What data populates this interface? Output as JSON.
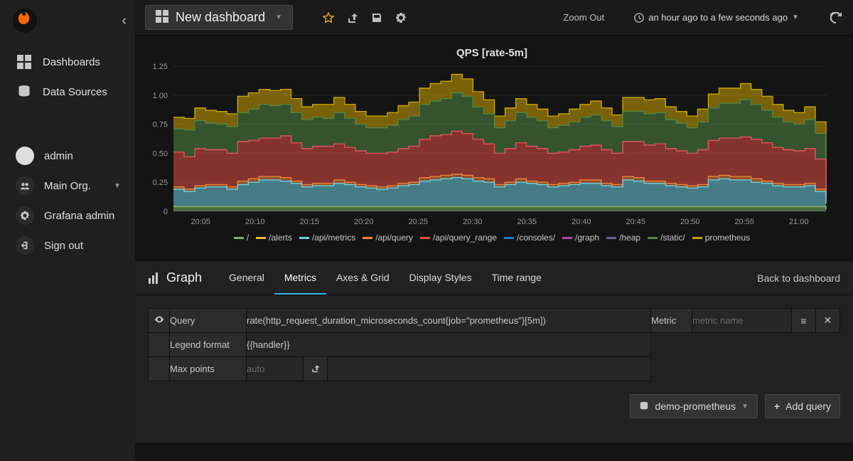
{
  "sidebar": {
    "nav": [
      {
        "label": "Dashboards",
        "icon": "dashboards"
      },
      {
        "label": "Data Sources",
        "icon": "datasources"
      }
    ],
    "user": "admin",
    "org": "Main Org.",
    "admin_link": "Grafana admin",
    "signout": "Sign out"
  },
  "topbar": {
    "dashboard_title": "New dashboard",
    "zoom_out": "Zoom Out",
    "time_range": "an hour ago to a few seconds ago"
  },
  "panel": {
    "title": "QPS [rate-5m]"
  },
  "editor": {
    "panel_type": "Graph",
    "tabs": [
      "General",
      "Metrics",
      "Axes & Grid",
      "Display Styles",
      "Time range"
    ],
    "active_tab": 1,
    "back": "Back to dashboard",
    "query_label": "Query",
    "query_value": "rate(http_request_duration_microseconds_count{job=\"prometheus\"}[5m])",
    "metric_label": "Metric",
    "metric_placeholder": "metric name",
    "legend_label": "Legend format",
    "legend_value": "{{handler}}",
    "maxpoints_label": "Max points",
    "maxpoints_placeholder": "auto",
    "datasource": "demo-prometheus",
    "add_query": "Add query"
  },
  "chart_data": {
    "type": "area",
    "title": "QPS [rate-5m]",
    "xlabel": "",
    "ylabel": "",
    "ylim": [
      0,
      1.25
    ],
    "yticks": [
      0,
      0.25,
      0.5,
      0.75,
      1.0,
      1.25
    ],
    "xticks": [
      "20:05",
      "20:10",
      "20:15",
      "20:20",
      "20:25",
      "20:30",
      "20:35",
      "20:40",
      "20:45",
      "20:50",
      "20:55",
      "21:00"
    ],
    "x": [
      0,
      1,
      2,
      3,
      4,
      5,
      6,
      7,
      8,
      9,
      10,
      11,
      12,
      13,
      14,
      15,
      16,
      17,
      18,
      19,
      20,
      21,
      22,
      23,
      24,
      25,
      26,
      27,
      28,
      29,
      30,
      31,
      32,
      33,
      34,
      35,
      36,
      37,
      38,
      39,
      40,
      41,
      42,
      43,
      44,
      45,
      46,
      47,
      48,
      49,
      50,
      51,
      52,
      53,
      54,
      55,
      56,
      57,
      58,
      59,
      60,
      61
    ],
    "stacked": true,
    "legend_position": "bottom",
    "series": [
      {
        "name": "/",
        "color": "#7eb26d",
        "values": [
          0.04,
          0.04,
          0.04,
          0.04,
          0.04,
          0.04,
          0.04,
          0.04,
          0.04,
          0.04,
          0.04,
          0.04,
          0.04,
          0.04,
          0.04,
          0.04,
          0.04,
          0.04,
          0.04,
          0.04,
          0.04,
          0.04,
          0.04,
          0.04,
          0.04,
          0.04,
          0.04,
          0.04,
          0.04,
          0.04,
          0.04,
          0.04,
          0.04,
          0.04,
          0.04,
          0.04,
          0.04,
          0.04,
          0.04,
          0.04,
          0.04,
          0.04,
          0.04,
          0.04,
          0.04,
          0.04,
          0.04,
          0.04,
          0.04,
          0.04,
          0.04,
          0.04,
          0.04,
          0.04,
          0.04,
          0.04,
          0.04,
          0.04,
          0.04,
          0.04,
          0.04,
          0.02
        ]
      },
      {
        "name": "/alerts",
        "color": "#eab839",
        "values": [
          0,
          0,
          0,
          0,
          0,
          0,
          0,
          0,
          0,
          0,
          0,
          0,
          0,
          0,
          0,
          0,
          0,
          0,
          0,
          0,
          0,
          0,
          0,
          0,
          0,
          0,
          0,
          0,
          0,
          0,
          0,
          0,
          0,
          0,
          0,
          0,
          0,
          0,
          0,
          0,
          0,
          0,
          0,
          0,
          0,
          0,
          0,
          0,
          0,
          0,
          0,
          0,
          0,
          0,
          0,
          0,
          0,
          0,
          0,
          0,
          0,
          0
        ]
      },
      {
        "name": "/api/metrics",
        "color": "#6ed0e0",
        "values": [
          0.15,
          0.13,
          0.16,
          0.17,
          0.17,
          0.15,
          0.19,
          0.21,
          0.23,
          0.23,
          0.22,
          0.2,
          0.17,
          0.18,
          0.18,
          0.2,
          0.19,
          0.17,
          0.16,
          0.15,
          0.16,
          0.18,
          0.19,
          0.22,
          0.23,
          0.24,
          0.25,
          0.24,
          0.22,
          0.21,
          0.17,
          0.19,
          0.21,
          0.2,
          0.19,
          0.17,
          0.18,
          0.19,
          0.2,
          0.2,
          0.18,
          0.17,
          0.23,
          0.22,
          0.2,
          0.2,
          0.18,
          0.17,
          0.16,
          0.17,
          0.23,
          0.24,
          0.23,
          0.23,
          0.21,
          0.2,
          0.18,
          0.17,
          0.17,
          0.18,
          0.13,
          0.05
        ]
      },
      {
        "name": "/api/query",
        "color": "#ef843c",
        "values": [
          0.02,
          0.02,
          0.02,
          0.02,
          0.02,
          0.02,
          0.03,
          0.03,
          0.03,
          0.03,
          0.03,
          0.02,
          0.02,
          0.02,
          0.02,
          0.03,
          0.02,
          0.02,
          0.02,
          0.02,
          0.02,
          0.02,
          0.02,
          0.03,
          0.03,
          0.03,
          0.03,
          0.03,
          0.03,
          0.03,
          0.02,
          0.02,
          0.03,
          0.02,
          0.02,
          0.02,
          0.02,
          0.02,
          0.03,
          0.03,
          0.02,
          0.02,
          0.03,
          0.03,
          0.02,
          0.02,
          0.02,
          0.02,
          0.02,
          0.02,
          0.03,
          0.03,
          0.03,
          0.03,
          0.03,
          0.02,
          0.02,
          0.02,
          0.02,
          0.02,
          0.02,
          0.01
        ]
      },
      {
        "name": "/api/query_range",
        "color": "#e24d42",
        "values": [
          0.3,
          0.28,
          0.32,
          0.3,
          0.3,
          0.29,
          0.34,
          0.33,
          0.33,
          0.33,
          0.36,
          0.33,
          0.31,
          0.32,
          0.32,
          0.31,
          0.3,
          0.29,
          0.28,
          0.29,
          0.29,
          0.3,
          0.31,
          0.33,
          0.35,
          0.35,
          0.37,
          0.36,
          0.33,
          0.3,
          0.27,
          0.29,
          0.31,
          0.3,
          0.29,
          0.27,
          0.27,
          0.28,
          0.29,
          0.3,
          0.29,
          0.27,
          0.3,
          0.31,
          0.31,
          0.32,
          0.3,
          0.29,
          0.28,
          0.3,
          0.31,
          0.32,
          0.33,
          0.34,
          0.34,
          0.33,
          0.31,
          0.3,
          0.29,
          0.3,
          0.26,
          0.04
        ]
      },
      {
        "name": "/consoles/",
        "color": "#1f78c1",
        "values": [
          0,
          0,
          0,
          0,
          0,
          0,
          0,
          0,
          0,
          0,
          0,
          0,
          0,
          0,
          0,
          0,
          0,
          0,
          0,
          0,
          0,
          0,
          0,
          0,
          0,
          0,
          0,
          0,
          0,
          0,
          0,
          0,
          0,
          0,
          0,
          0,
          0,
          0,
          0,
          0,
          0,
          0,
          0,
          0,
          0,
          0,
          0,
          0,
          0,
          0,
          0,
          0,
          0,
          0,
          0,
          0,
          0,
          0,
          0,
          0,
          0,
          0
        ]
      },
      {
        "name": "/graph",
        "color": "#ba43a9",
        "values": [
          0,
          0,
          0,
          0,
          0,
          0,
          0,
          0,
          0,
          0,
          0,
          0,
          0,
          0,
          0,
          0,
          0,
          0,
          0,
          0,
          0,
          0,
          0,
          0,
          0,
          0,
          0,
          0,
          0,
          0,
          0,
          0,
          0,
          0,
          0,
          0,
          0,
          0,
          0,
          0,
          0,
          0,
          0,
          0,
          0,
          0,
          0,
          0,
          0,
          0,
          0,
          0,
          0,
          0,
          0,
          0,
          0,
          0,
          0,
          0,
          0,
          0
        ]
      },
      {
        "name": "/heap",
        "color": "#705da0",
        "values": [
          0,
          0,
          0,
          0,
          0,
          0,
          0,
          0,
          0,
          0,
          0,
          0,
          0,
          0,
          0,
          0,
          0,
          0,
          0,
          0,
          0,
          0,
          0,
          0,
          0,
          0,
          0,
          0,
          0,
          0,
          0,
          0,
          0,
          0,
          0,
          0,
          0,
          0,
          0,
          0,
          0,
          0,
          0,
          0,
          0,
          0,
          0,
          0,
          0,
          0,
          0,
          0,
          0,
          0,
          0,
          0,
          0,
          0,
          0,
          0,
          0,
          0
        ]
      },
      {
        "name": "/static/",
        "color": "#508642",
        "values": [
          0.2,
          0.23,
          0.24,
          0.23,
          0.22,
          0.23,
          0.25,
          0.27,
          0.29,
          0.28,
          0.27,
          0.26,
          0.25,
          0.25,
          0.24,
          0.27,
          0.25,
          0.23,
          0.22,
          0.22,
          0.23,
          0.25,
          0.26,
          0.3,
          0.3,
          0.31,
          0.33,
          0.32,
          0.28,
          0.26,
          0.22,
          0.24,
          0.26,
          0.25,
          0.24,
          0.22,
          0.23,
          0.24,
          0.25,
          0.26,
          0.25,
          0.23,
          0.26,
          0.26,
          0.27,
          0.27,
          0.25,
          0.24,
          0.22,
          0.24,
          0.28,
          0.3,
          0.3,
          0.32,
          0.3,
          0.28,
          0.26,
          0.24,
          0.23,
          0.25,
          0.22,
          0.04
        ]
      },
      {
        "name": "prometheus",
        "color": "#cca300",
        "values": [
          0.1,
          0.1,
          0.11,
          0.11,
          0.11,
          0.11,
          0.14,
          0.14,
          0.13,
          0.13,
          0.13,
          0.12,
          0.11,
          0.11,
          0.12,
          0.13,
          0.12,
          0.11,
          0.1,
          0.1,
          0.11,
          0.12,
          0.12,
          0.14,
          0.15,
          0.15,
          0.16,
          0.15,
          0.13,
          0.12,
          0.1,
          0.11,
          0.12,
          0.11,
          0.1,
          0.1,
          0.1,
          0.11,
          0.11,
          0.12,
          0.11,
          0.1,
          0.12,
          0.12,
          0.12,
          0.12,
          0.11,
          0.1,
          0.1,
          0.11,
          0.12,
          0.13,
          0.13,
          0.14,
          0.13,
          0.12,
          0.11,
          0.1,
          0.1,
          0.11,
          0.1,
          0.02
        ]
      }
    ]
  }
}
